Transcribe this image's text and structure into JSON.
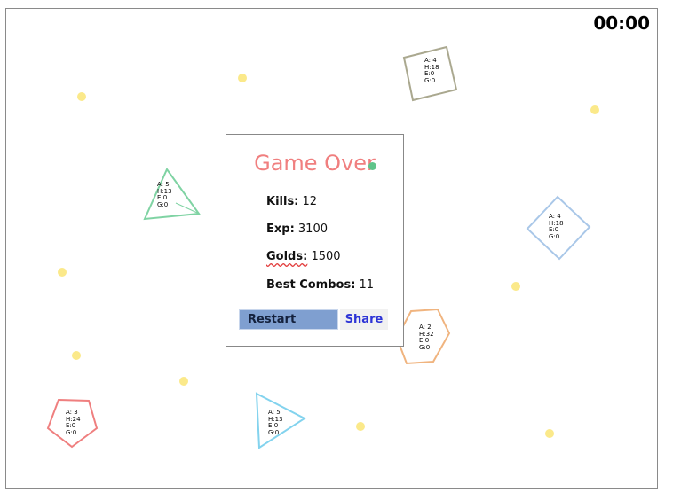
{
  "timer": "00:00",
  "game_over": {
    "title": "Game Over",
    "kills_label": "Kills:",
    "kills_value": " 12",
    "exp_label": "Exp:",
    "exp_value": " 3100",
    "golds_label": "Golds:",
    "golds_value": " 1500",
    "combos_label": "Best Combos:",
    "combos_value": " 11",
    "restart_label": "Restart",
    "share_label": "Share"
  },
  "enemies": [
    {
      "shape": "square",
      "color": "#aaa88f",
      "a": "A: 4",
      "h": "H:18",
      "e": "E:0",
      "g": "G:0"
    },
    {
      "shape": "triangle",
      "color": "#7fd3a3",
      "a": "A: 5",
      "h": "H:13",
      "e": "E:0",
      "g": "G:0"
    },
    {
      "shape": "diamond",
      "color": "#a9c7e8",
      "a": "A: 4",
      "h": "H:18",
      "e": "E:0",
      "g": "G:0"
    },
    {
      "shape": "hexagon",
      "color": "#f0b47f",
      "a": "A: 2",
      "h": "H:32",
      "e": "E:0",
      "g": "G:0"
    },
    {
      "shape": "pentagon",
      "color": "#ef7f7f",
      "a": "A: 3",
      "h": "H:24",
      "e": "E:0",
      "g": "G:0"
    },
    {
      "shape": "triangle",
      "color": "#83d3ee",
      "a": "A: 5",
      "h": "H:13",
      "e": "E:0",
      "g": "G:0"
    }
  ],
  "colors": {
    "pickup": "#fbe98a",
    "title": "#f07f7f",
    "restart_bg": "#7f9fd0",
    "share_text": "#2d34d6"
  }
}
